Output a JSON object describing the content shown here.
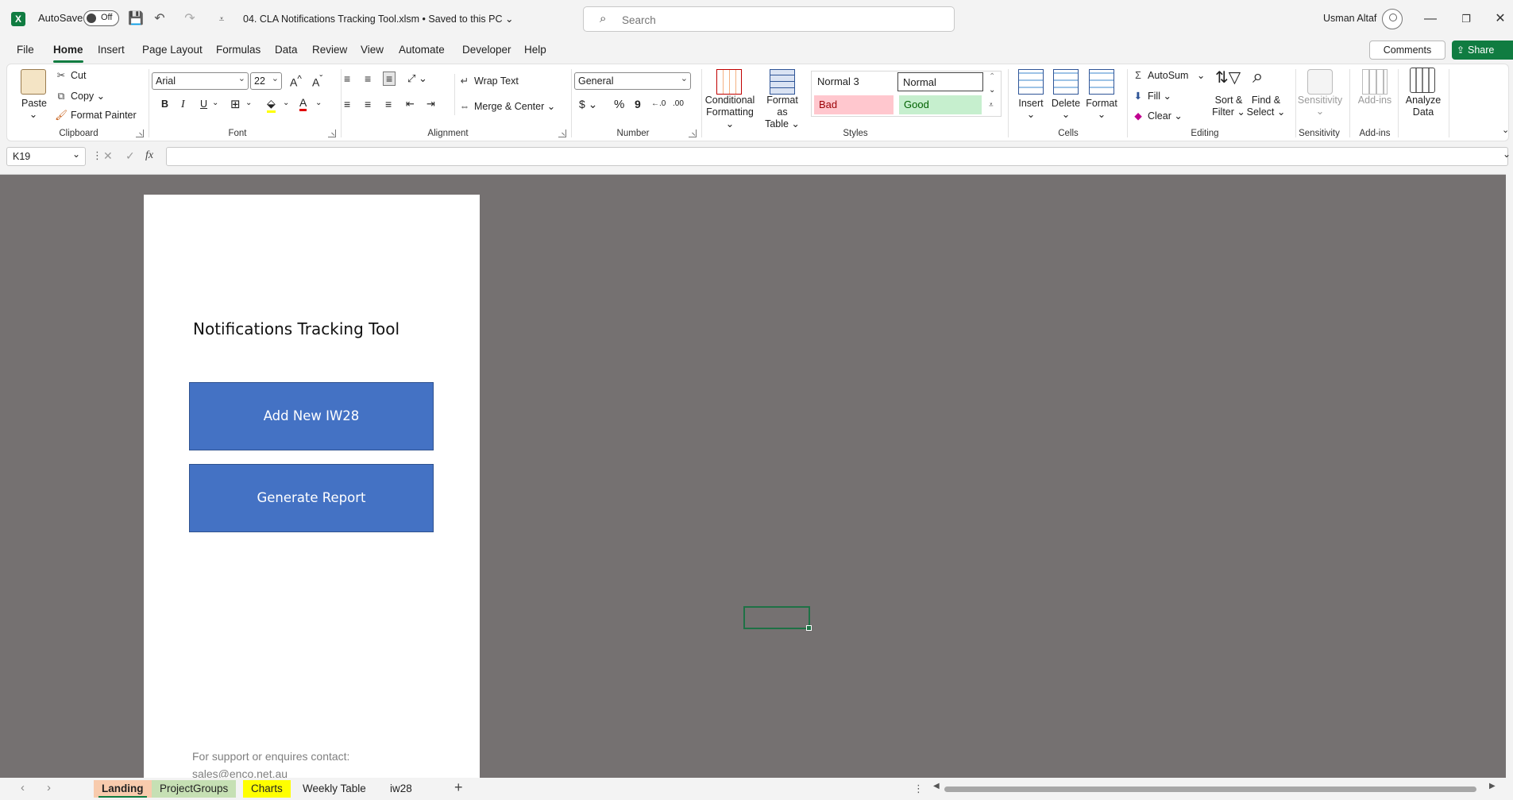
{
  "titlebar": {
    "autosave_label": "AutoSave",
    "autosave_state": "Off",
    "filename": "04. CLA Notifications Tracking Tool.xlsm • Saved to this PC ⌄",
    "search_placeholder": "Search",
    "user_name": "Usman Altaf"
  },
  "menu": {
    "tabs": [
      "File",
      "Home",
      "Insert",
      "Page Layout",
      "Formulas",
      "Data",
      "Review",
      "View",
      "Automate",
      "Developer",
      "Help"
    ],
    "comments": "Comments",
    "share": "Share"
  },
  "ribbon": {
    "clipboard": {
      "paste": "Paste",
      "cut": "Cut",
      "copy": "Copy",
      "format_painter": "Format Painter",
      "label": "Clipboard"
    },
    "font": {
      "name": "Arial",
      "size": "22",
      "label": "Font",
      "bold": "B",
      "italic": "I",
      "underline": "U"
    },
    "alignment": {
      "wrap_text": "Wrap Text",
      "merge_center": "Merge & Center",
      "label": "Alignment"
    },
    "number": {
      "format": "General",
      "label": "Number"
    },
    "styles": {
      "conditional": "Conditional",
      "formatting": "Formatting ⌄",
      "format_as": "Format as",
      "table": "Table ⌄",
      "normal3": "Normal 3",
      "normal": "Normal",
      "bad": "Bad",
      "good": "Good",
      "label": "Styles"
    },
    "cells": {
      "insert": "Insert",
      "delete": "Delete",
      "format": "Format",
      "label": "Cells"
    },
    "editing": {
      "autosum": "AutoSum",
      "fill": "Fill ⌄",
      "clear": "Clear ⌄",
      "sort_filter_1": "Sort &",
      "sort_filter_2": "Filter ⌄",
      "find_select_1": "Find &",
      "find_select_2": "Select ⌄",
      "label": "Editing"
    },
    "sensitivity": {
      "button": "Sensitivity",
      "label": "Sensitivity"
    },
    "addins": {
      "button": "Add-ins",
      "label": "Add-ins"
    },
    "analyze": {
      "line1": "Analyze",
      "line2": "Data"
    }
  },
  "formula_bar": {
    "name_box": "K19",
    "fx": "fx"
  },
  "sheet": {
    "title": "Notifications Tracking Tool",
    "btn_add": "Add New IW28",
    "btn_report": "Generate Report",
    "support_text": "For support or enquires contact:",
    "support_email": "sales@enco.net.au"
  },
  "sheet_tabs": [
    {
      "name": "Landing",
      "color": "#f8cbad"
    },
    {
      "name": "ProjectGroups",
      "color": "#c6e0b4"
    },
    {
      "name": "Charts",
      "color": "#ffff00"
    },
    {
      "name": "Weekly Table",
      "color": ""
    },
    {
      "name": "iw28",
      "color": ""
    }
  ],
  "colors": {
    "excel_green": "#107c41",
    "button_blue": "#4472c4",
    "sheet_bg": "#757171"
  }
}
